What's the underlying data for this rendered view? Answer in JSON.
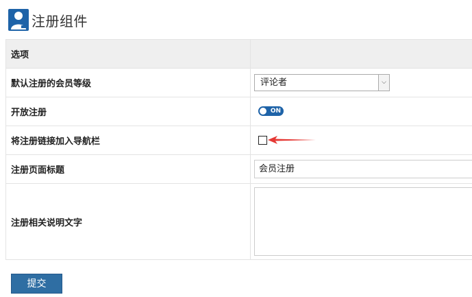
{
  "header": {
    "title": "注册组件",
    "icon": "user-icon"
  },
  "table": {
    "head_label": "选项",
    "rows": {
      "level": {
        "label": "默认注册的会员等级",
        "value": "评论者"
      },
      "open": {
        "label": "开放注册",
        "toggle_text": "ON",
        "state": "on"
      },
      "navlink": {
        "label": "将注册链接加入导航栏",
        "checked": false
      },
      "page_title": {
        "label": "注册页面标题",
        "value": "会员注册"
      },
      "description": {
        "label": "注册相关说明文字",
        "value": ""
      }
    }
  },
  "submit_label": "提交",
  "colors": {
    "accent": "#1e63a8",
    "arrow": "#e53935"
  }
}
